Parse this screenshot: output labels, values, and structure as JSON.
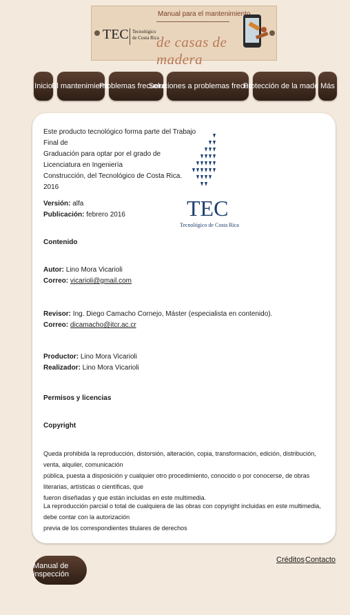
{
  "banner": {
    "logo_text": "TEC",
    "logo_sub_1": "Tecnológico",
    "logo_sub_2": "de Costa Rica",
    "title_line1": "Manual para el mantenimiento",
    "title_line2": "de casas de madera"
  },
  "nav": {
    "items": [
      {
        "label": "Inicio"
      },
      {
        "label": "El mantenimiento"
      },
      {
        "label": "Problemas frecuentes"
      },
      {
        "label": "Soluciones a problemas frecuentes"
      },
      {
        "label": "Protección de la madera"
      },
      {
        "label": "Más"
      }
    ]
  },
  "content": {
    "intro_1": "Este producto tecnológico forma parte del Trabajo Final de",
    "intro_2": "Graduación para optar por el grado de Licenciatura en Ingeniería",
    "intro_3": "Construcción, del Tecnológico de Costa Rica.",
    "intro_year": "2016",
    "version_label": "Versión:",
    "version_value": " alfa",
    "publication_label": "Publicación:",
    "publication_value": " febrero 2016",
    "contenido": "Contenido",
    "autor_label": "Autor:",
    "autor_value": " Lino Mora Vicarioli",
    "correo_label": "Correo:",
    "autor_email": "vicarioli@gmail.com",
    "revisor_label": "Revisor:",
    "revisor_value": " Ing. Diego Camacho Cornejo, Máster (especialista en contenido).",
    "revisor_email": "dicamacho@itcr.ac.cr",
    "productor_label": "Productor:",
    "productor_value": " Lino Mora Vicarioli",
    "realizador_label": "Realizador:",
    "realizador_value": " Lino Mora Vicarioli",
    "permisos": "Permisos y licencias",
    "copyright": "Copyright",
    "copy_p1_l1": "Queda prohibida la reproducción, distorsión, alteración, copia, transformación, edición, distribución, venta, alquiler, comunicación",
    "copy_p1_l2": "pública, puesta a disposición y cualquier otro procedimiento, conocido o por conocerse, de obras literarias, artísticas o científicas, que",
    "copy_p1_l3": "fueron diseñadas y que están incluidas en este multimedia.",
    "copy_p2_l1": "La reproducción parcial o total de cualquiera de las obras con copyright incluidas en este multimedia, debe contar con la autorización",
    "copy_p2_l2": "previa de los correspondientes titulares de derechos"
  },
  "logo": {
    "mark": "TEC",
    "caption": "Tecnológico de Costa Rica"
  },
  "footer": {
    "manual_button": "Manual de inspección",
    "creditos": "Créditos",
    "contacto": "Contacto"
  },
  "colors": {
    "page_bg": "#f4e9dd",
    "button_dark": "#3f2b20",
    "logo_blue": "#1f3e6e"
  }
}
